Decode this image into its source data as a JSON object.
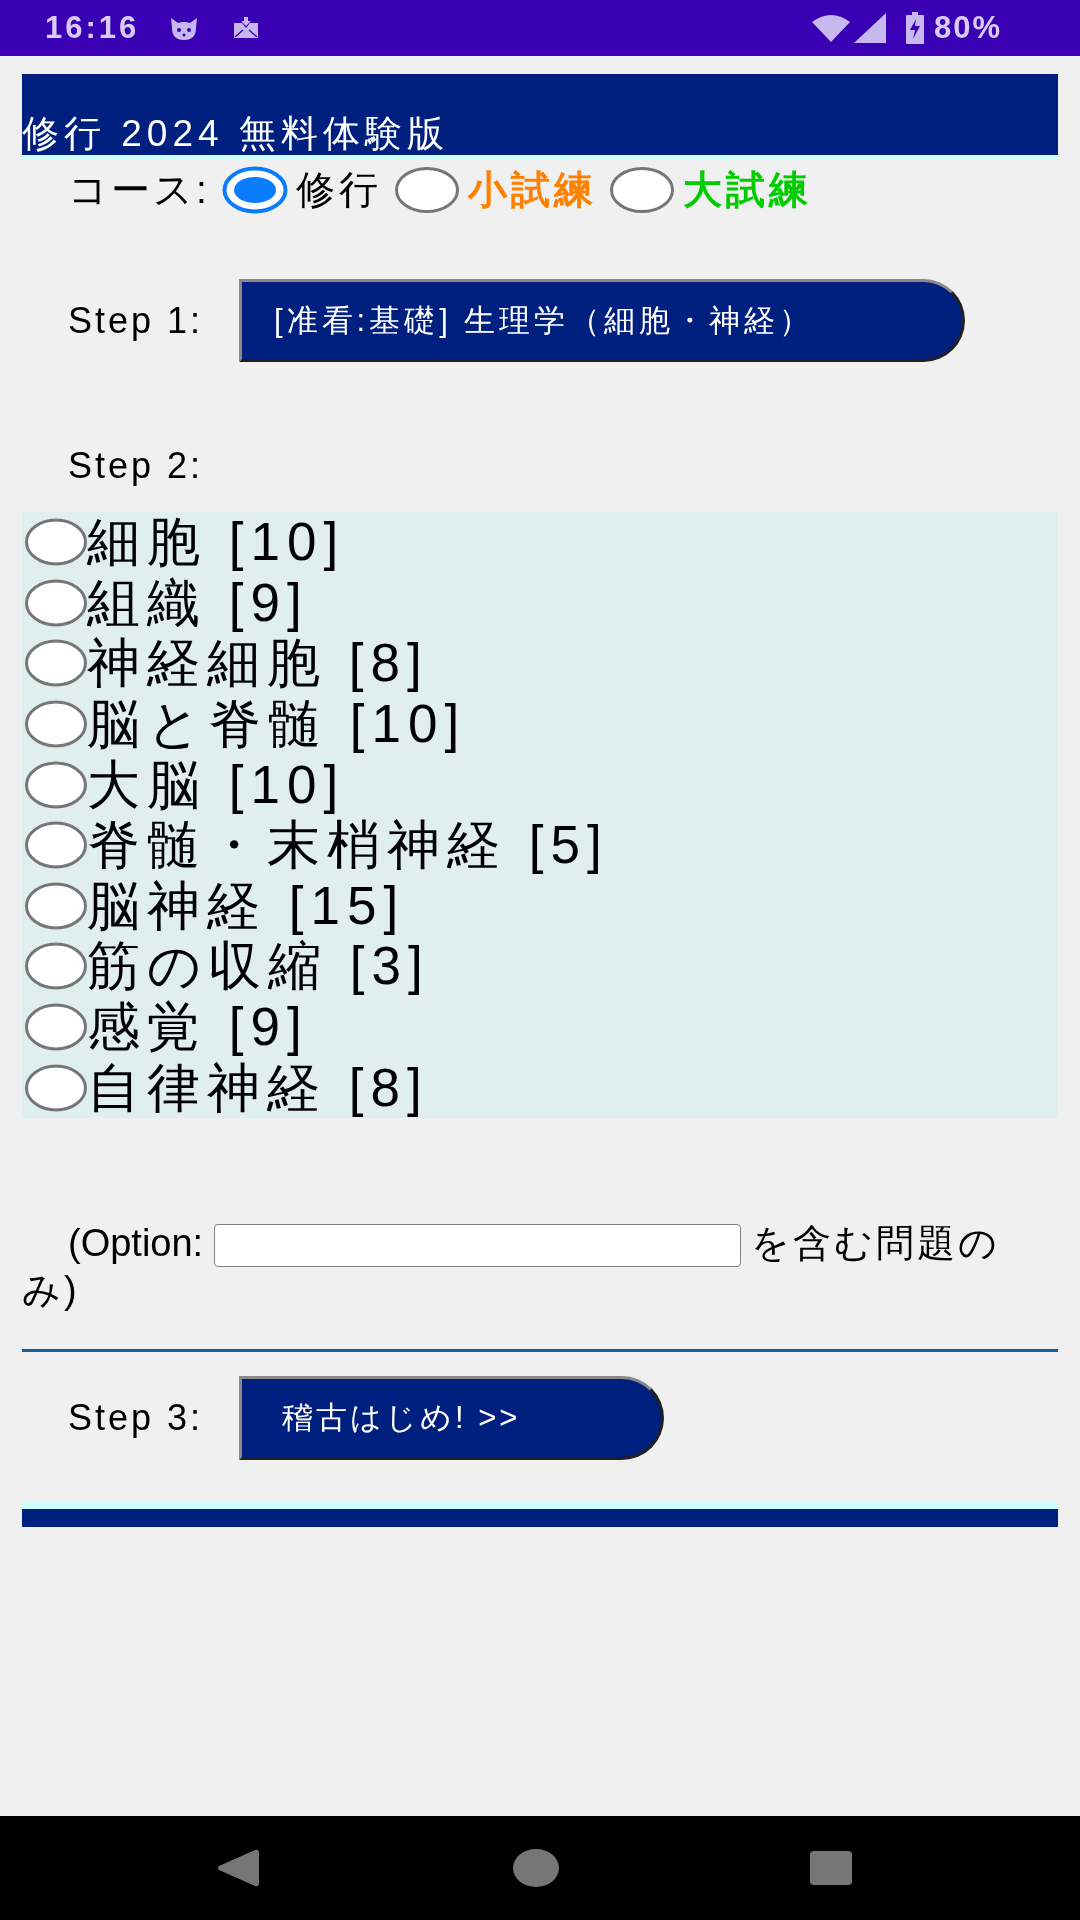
{
  "status_bar": {
    "time": "16:16",
    "battery": "80%"
  },
  "header": {
    "title": "修行 2024 無料体験版"
  },
  "course": {
    "label": "コース:",
    "options": [
      {
        "label": "修行",
        "kind": "plain",
        "color": "#000000",
        "selected": true
      },
      {
        "label": "小試練",
        "kind": "accent",
        "color": "#ff8000",
        "selected": false
      },
      {
        "label": "大試練",
        "kind": "accent",
        "color": "#00cc00",
        "selected": false
      }
    ]
  },
  "step1": {
    "label": "Step 1:",
    "button": "[准看:基礎] 生理学（細胞・神経）"
  },
  "step2": {
    "label": "Step 2:",
    "topics": [
      {
        "label": "細胞 [10]",
        "selected": false
      },
      {
        "label": "組織 [9]",
        "selected": false
      },
      {
        "label": "神経細胞 [8]",
        "selected": false
      },
      {
        "label": "脳と脊髄 [10]",
        "selected": false
      },
      {
        "label": "大脳 [10]",
        "selected": false
      },
      {
        "label": "脊髄・末梢神経 [5]",
        "selected": false
      },
      {
        "label": "脳神経 [15]",
        "selected": false
      },
      {
        "label": "筋の収縮 [3]",
        "selected": false
      },
      {
        "label": "感覚 [9]",
        "selected": false
      },
      {
        "label": "自律神経 [8]",
        "selected": false
      }
    ]
  },
  "option": {
    "prefix": "(Option:",
    "suffix": "を含む問題のみ)"
  },
  "step3": {
    "label": "Step 3:",
    "button": "稽古はじめ! >>"
  }
}
